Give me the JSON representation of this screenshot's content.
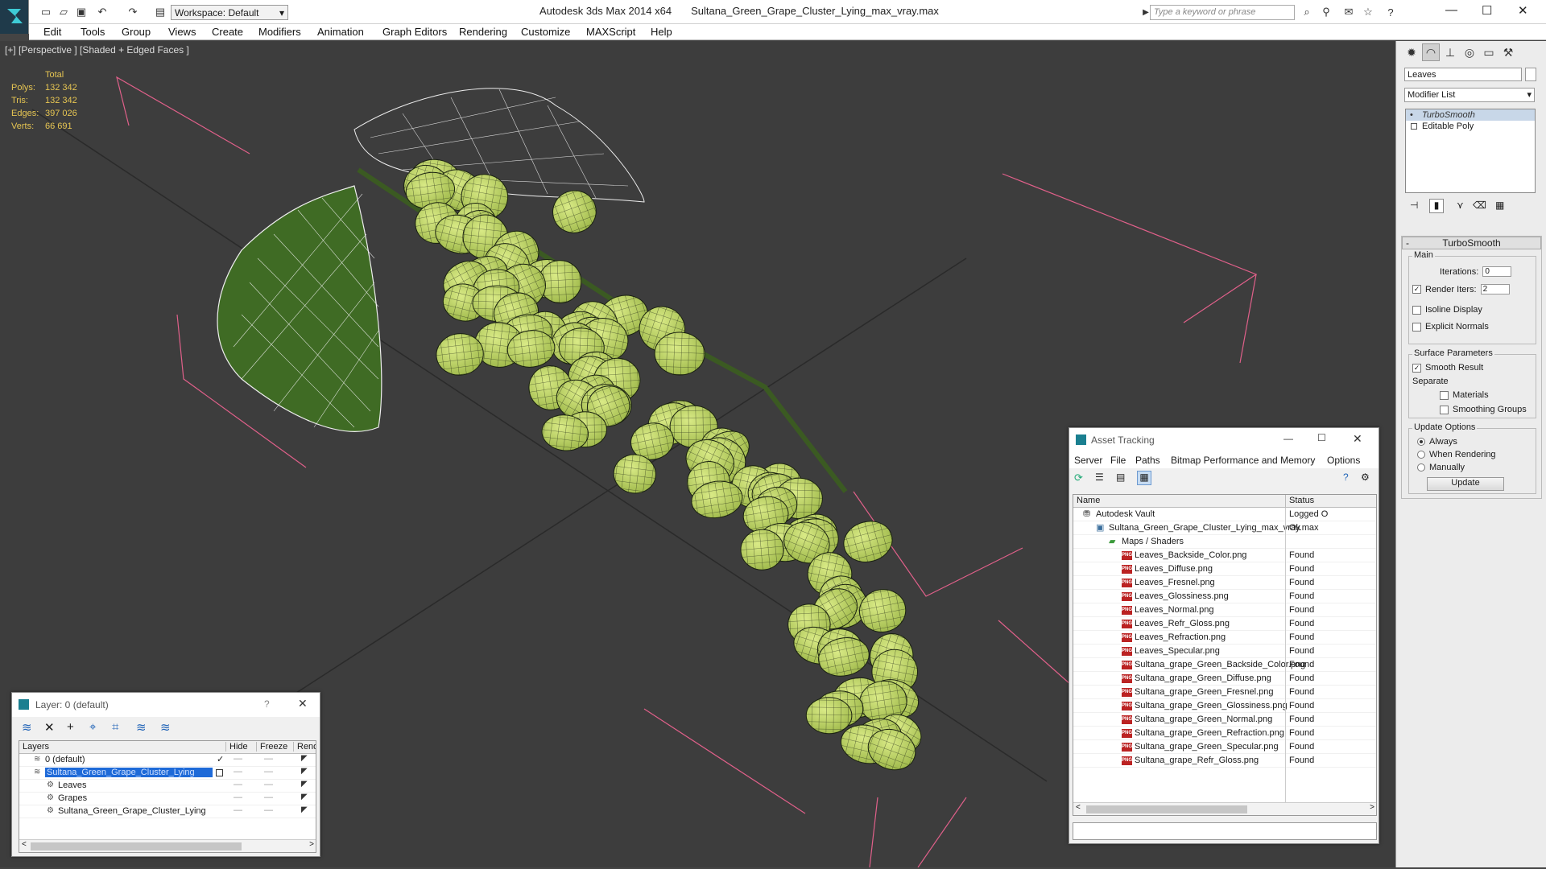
{
  "window": {
    "app_title": "Autodesk 3ds Max  2014 x64",
    "file_title": "Sultana_Green_Grape_Cluster_Lying_max_vray.max",
    "workspace": "Workspace: Default",
    "search_placeholder": "Type a keyword or phrase"
  },
  "menu": [
    "Edit",
    "Tools",
    "Group",
    "Views",
    "Create",
    "Modifiers",
    "Animation",
    "Graph Editors",
    "Rendering",
    "Customize",
    "MAXScript",
    "Help"
  ],
  "viewport": {
    "label": "[+] [Perspective ] [Shaded + Edged Faces ]",
    "stats": {
      "header": "Total",
      "rows": [
        {
          "k": "Polys:",
          "v": "132 342"
        },
        {
          "k": "Tris:",
          "v": "132 342"
        },
        {
          "k": "Edges:",
          "v": "397 026"
        },
        {
          "k": "Verts:",
          "v": "66 691"
        }
      ]
    }
  },
  "command_panel": {
    "object_name": "Leaves",
    "modifier_list": "Modifier List",
    "stack": [
      "TurboSmooth",
      "Editable Poly"
    ],
    "rollout_title": "TurboSmooth",
    "main_group": "Main",
    "iterations_label": "Iterations:",
    "iterations_value": "0",
    "render_iters_label": "Render Iters:",
    "render_iters_value": "2",
    "isoline": "Isoline Display",
    "explicit": "Explicit Normals",
    "surface_group": "Surface Parameters",
    "smooth_result": "Smooth Result",
    "separate": "Separate",
    "materials": "Materials",
    "smoothing_groups": "Smoothing Groups",
    "update_group": "Update Options",
    "always": "Always",
    "when_rendering": "When Rendering",
    "manually": "Manually",
    "update_btn": "Update"
  },
  "asset_tracking": {
    "title": "Asset Tracking",
    "menu": [
      "Server",
      "File",
      "Paths",
      "Bitmap Performance and Memory",
      "Options"
    ],
    "col_name": "Name",
    "col_status": "Status",
    "rows": [
      {
        "name": "Autodesk Vault",
        "status": "Logged O",
        "indent": 1,
        "icon": "vault"
      },
      {
        "name": "Sultana_Green_Grape_Cluster_Lying_max_vray.max",
        "status": "Ok",
        "indent": 2,
        "icon": "max"
      },
      {
        "name": "Maps / Shaders",
        "status": "",
        "indent": 3,
        "icon": "maps"
      },
      {
        "name": "Leaves_Backside_Color.png",
        "status": "Found",
        "indent": 4,
        "icon": "png"
      },
      {
        "name": "Leaves_Diffuse.png",
        "status": "Found",
        "indent": 4,
        "icon": "png"
      },
      {
        "name": "Leaves_Fresnel.png",
        "status": "Found",
        "indent": 4,
        "icon": "png"
      },
      {
        "name": "Leaves_Glossiness.png",
        "status": "Found",
        "indent": 4,
        "icon": "png"
      },
      {
        "name": "Leaves_Normal.png",
        "status": "Found",
        "indent": 4,
        "icon": "png"
      },
      {
        "name": "Leaves_Refr_Gloss.png",
        "status": "Found",
        "indent": 4,
        "icon": "png"
      },
      {
        "name": "Leaves_Refraction.png",
        "status": "Found",
        "indent": 4,
        "icon": "png"
      },
      {
        "name": "Leaves_Specular.png",
        "status": "Found",
        "indent": 4,
        "icon": "png"
      },
      {
        "name": "Sultana_grape_Green_Backside_Color.png",
        "status": "Found",
        "indent": 4,
        "icon": "png"
      },
      {
        "name": "Sultana_grape_Green_Diffuse.png",
        "status": "Found",
        "indent": 4,
        "icon": "png"
      },
      {
        "name": "Sultana_grape_Green_Fresnel.png",
        "status": "Found",
        "indent": 4,
        "icon": "png"
      },
      {
        "name": "Sultana_grape_Green_Glossiness.png",
        "status": "Found",
        "indent": 4,
        "icon": "png"
      },
      {
        "name": "Sultana_grape_Green_Normal.png",
        "status": "Found",
        "indent": 4,
        "icon": "png"
      },
      {
        "name": "Sultana_grape_Green_Refraction.png",
        "status": "Found",
        "indent": 4,
        "icon": "png"
      },
      {
        "name": "Sultana_grape_Green_Specular.png",
        "status": "Found",
        "indent": 4,
        "icon": "png"
      },
      {
        "name": "Sultana_grape_Refr_Gloss.png",
        "status": "Found",
        "indent": 4,
        "icon": "png"
      }
    ]
  },
  "layer_panel": {
    "title": "Layer: 0 (default)",
    "help": "?",
    "col_layers": "Layers",
    "col_hide": "Hide",
    "col_freeze": "Freeze",
    "col_render": "Rende",
    "rows": [
      {
        "name": "0 (default)",
        "indent": 1,
        "selected": false,
        "current": true
      },
      {
        "name": "Sultana_Green_Grape_Cluster_Lying",
        "indent": 1,
        "selected": true,
        "current": false
      },
      {
        "name": "Leaves",
        "indent": 2,
        "selected": false,
        "current": false
      },
      {
        "name": "Grapes",
        "indent": 2,
        "selected": false,
        "current": false
      },
      {
        "name": "Sultana_Green_Grape_Cluster_Lying",
        "indent": 2,
        "selected": false,
        "current": false
      }
    ]
  },
  "colors": {
    "accent": "#3399ff",
    "stats": "#e6c552",
    "grape": "#c6dc6a",
    "selection": "#1e6ad8"
  }
}
